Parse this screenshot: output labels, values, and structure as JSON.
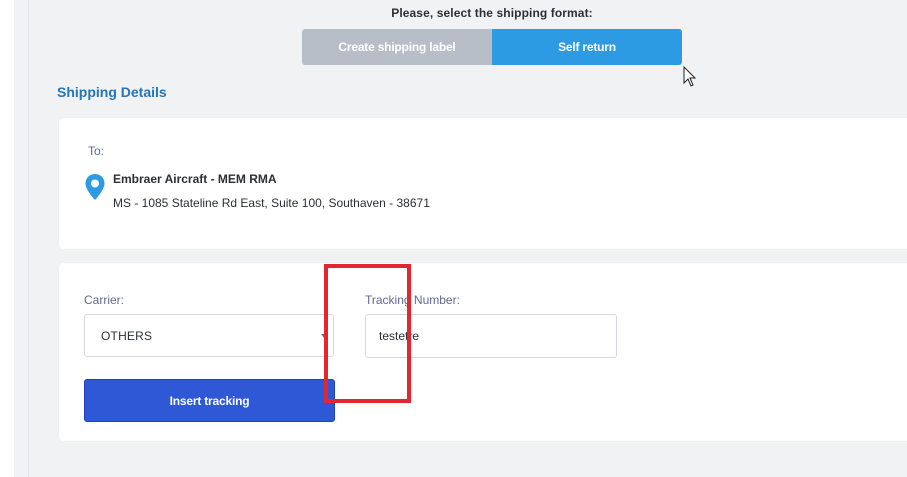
{
  "shipping_format": {
    "title": "Please, select the shipping format:",
    "options": [
      {
        "label": "Create shipping label",
        "selected": false
      },
      {
        "label": "Self return",
        "selected": true
      }
    ]
  },
  "shipping_details": {
    "section_title": "Shipping Details",
    "to_label": "To:",
    "company": "Embraer Aircraft - MEM RMA",
    "address": "MS - 1085 Stateline Rd East, Suite 100, Southaven - 38671",
    "icon": "map-pin-icon"
  },
  "tracking_form": {
    "carrier_label": "Carrier:",
    "carrier_value": "OTHERS",
    "tracking_label": "Tracking Number:",
    "tracking_value": "testetre",
    "submit_label": "Insert tracking"
  },
  "colors": {
    "accent_blue": "#2c9be3",
    "primary_button": "#2f58d6",
    "disabled_gray": "#b7bec8",
    "section_title": "#2476b7",
    "highlight_red": "#e3262f"
  }
}
